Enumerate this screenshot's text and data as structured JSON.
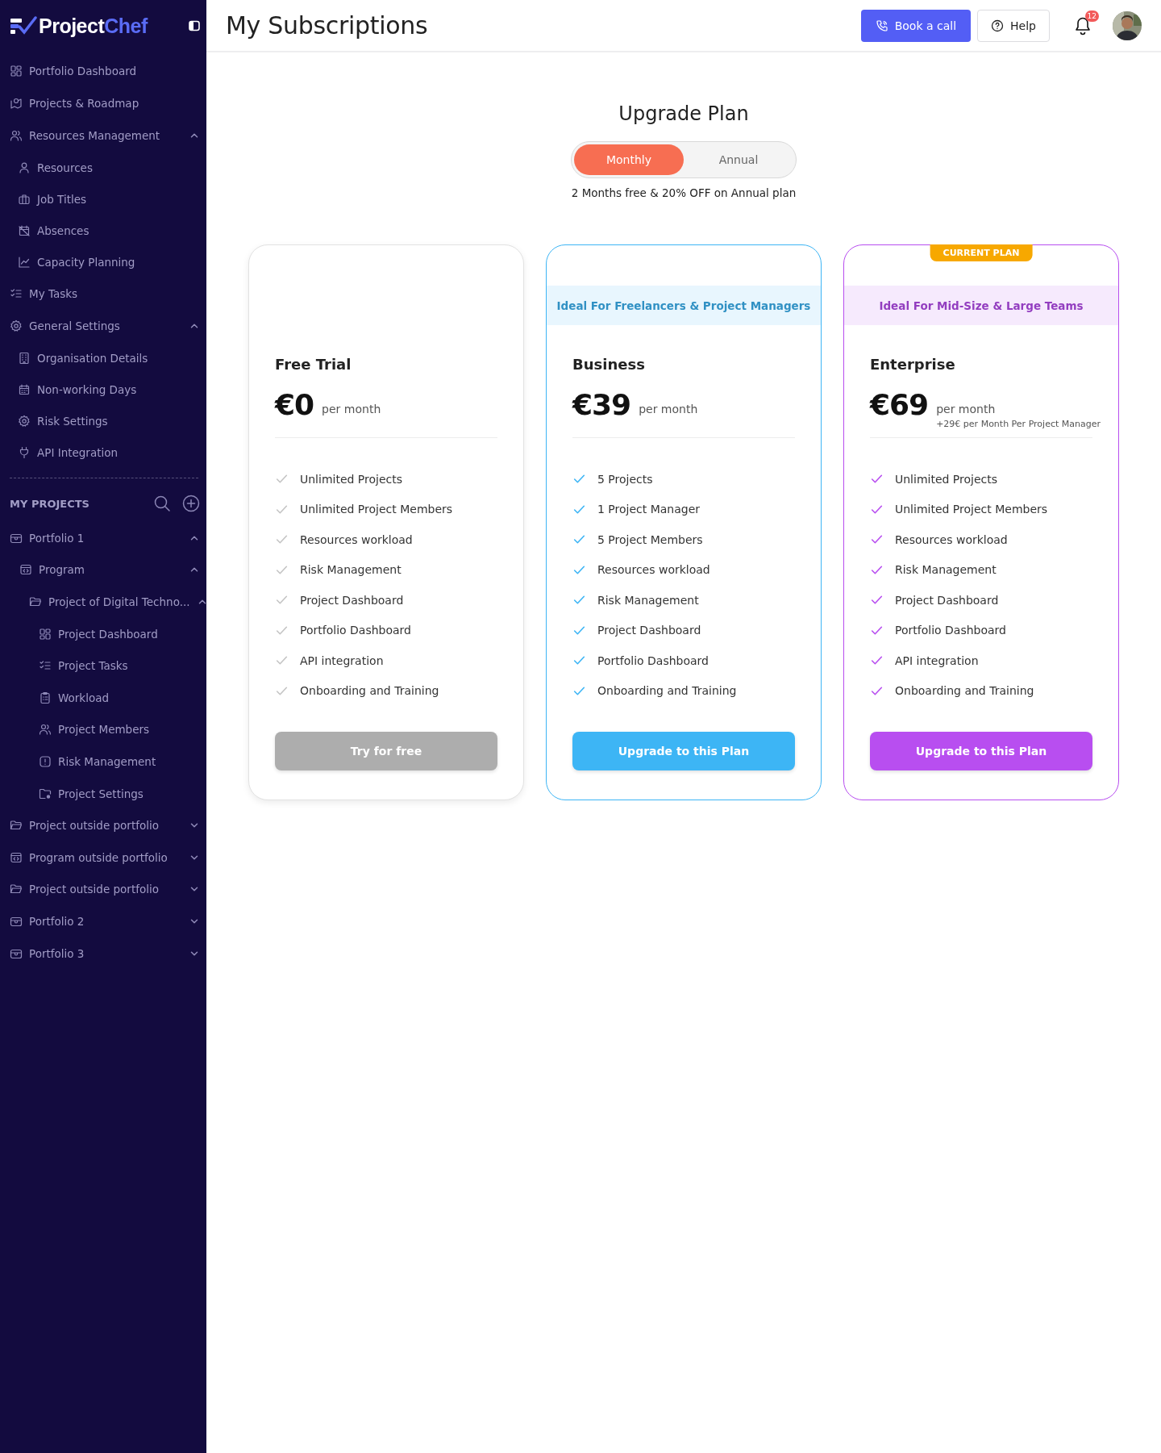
{
  "sidebar": {
    "logo": {
      "part_1": "Project",
      "part_2": "Chef"
    },
    "nav": [
      {
        "label": "Portfolio Dashboard"
      },
      {
        "label": "Projects & Roadmap"
      },
      {
        "label": "Resources Management",
        "expanded": true,
        "children": [
          {
            "label": "Resources"
          },
          {
            "label": "Job Titles"
          },
          {
            "label": "Absences"
          },
          {
            "label": "Capacity Planning"
          }
        ]
      },
      {
        "label": "My Tasks"
      },
      {
        "label": "General Settings",
        "expanded": true,
        "children": [
          {
            "label": "Organisation Details"
          },
          {
            "label": "Non-working Days"
          },
          {
            "label": "Risk Settings"
          },
          {
            "label": "API Integration"
          }
        ]
      }
    ],
    "projects_heading": "MY PROJECTS",
    "projects": [
      {
        "label": "Portfolio 1",
        "kind": "portfolio",
        "expanded": true,
        "children": [
          {
            "label": "Program",
            "kind": "program",
            "expanded": true,
            "children": [
              {
                "label": "Project of Digital Techno...",
                "kind": "project",
                "expanded": true,
                "children": [
                  {
                    "label": "Project Dashboard",
                    "kind": "dashboard"
                  },
                  {
                    "label": "Project Tasks",
                    "kind": "tasks"
                  },
                  {
                    "label": "Workload",
                    "kind": "clipboard"
                  },
                  {
                    "label": "Project Members",
                    "kind": "members"
                  },
                  {
                    "label": "Risk Management",
                    "kind": "risk"
                  },
                  {
                    "label": "Project Settings",
                    "kind": "folder-settings"
                  }
                ]
              }
            ]
          }
        ]
      },
      {
        "label": "Project outside portfolio",
        "kind": "project",
        "expanded": false
      },
      {
        "label": "Program outside portfolio",
        "kind": "program",
        "expanded": false
      },
      {
        "label": "Project outside portfolio",
        "kind": "project",
        "expanded": false
      },
      {
        "label": "Portfolio 2",
        "kind": "portfolio",
        "expanded": false
      },
      {
        "label": "Portfolio 3",
        "kind": "portfolio",
        "expanded": false
      }
    ]
  },
  "header": {
    "title": "My Subscriptions",
    "book_call": "Book a call",
    "help": "Help",
    "notification_count": "12"
  },
  "upgrade": {
    "title": "Upgrade Plan",
    "billing": [
      {
        "label": "Monthly",
        "selected": true
      },
      {
        "label": "Annual",
        "selected": false
      }
    ],
    "note": "2 Months free & 20% OFF on Annual plan"
  },
  "plans": [
    {
      "name": "Free Trial",
      "price": "€0",
      "period": "per month",
      "color": "#c4c4c4",
      "current": false,
      "features": [
        "Unlimited Projects",
        "Unlimited Project Members",
        "Resources workload",
        "Risk Management",
        "Project Dashboard",
        "Portfolio Dashboard",
        "API integration",
        "Onboarding and Training"
      ],
      "button": {
        "label": "Try for free",
        "disabled": true
      }
    },
    {
      "name": "Business",
      "price": "€39",
      "period": "per month",
      "color": "#3db5f5",
      "current": false,
      "tagline": "Ideal For Freelancers & Project Managers",
      "features": [
        "5 Projects",
        "1 Project Manager",
        "5 Project Members",
        "Resources workload",
        "Risk Management",
        "Project Dashboard",
        "Portfolio Dashboard",
        "Onboarding and Training"
      ],
      "button": {
        "label": "Upgrade to this Plan",
        "disabled": false
      }
    },
    {
      "name": "Enterprise",
      "price": "€69",
      "period": "per month",
      "extra": "+29€ per Month Per Project Manager",
      "color": "#b84ef0",
      "current": true,
      "badge": "CURRENT PLAN",
      "tagline": "Ideal For Mid-Size & Large Teams",
      "features": [
        "Unlimited Projects",
        "Unlimited Project Members",
        "Resources workload",
        "Risk Management",
        "Project Dashboard",
        "Portfolio Dashboard",
        "API integration",
        "Onboarding and Training"
      ],
      "button": {
        "label": "Upgrade to this Plan",
        "disabled": false
      }
    }
  ]
}
